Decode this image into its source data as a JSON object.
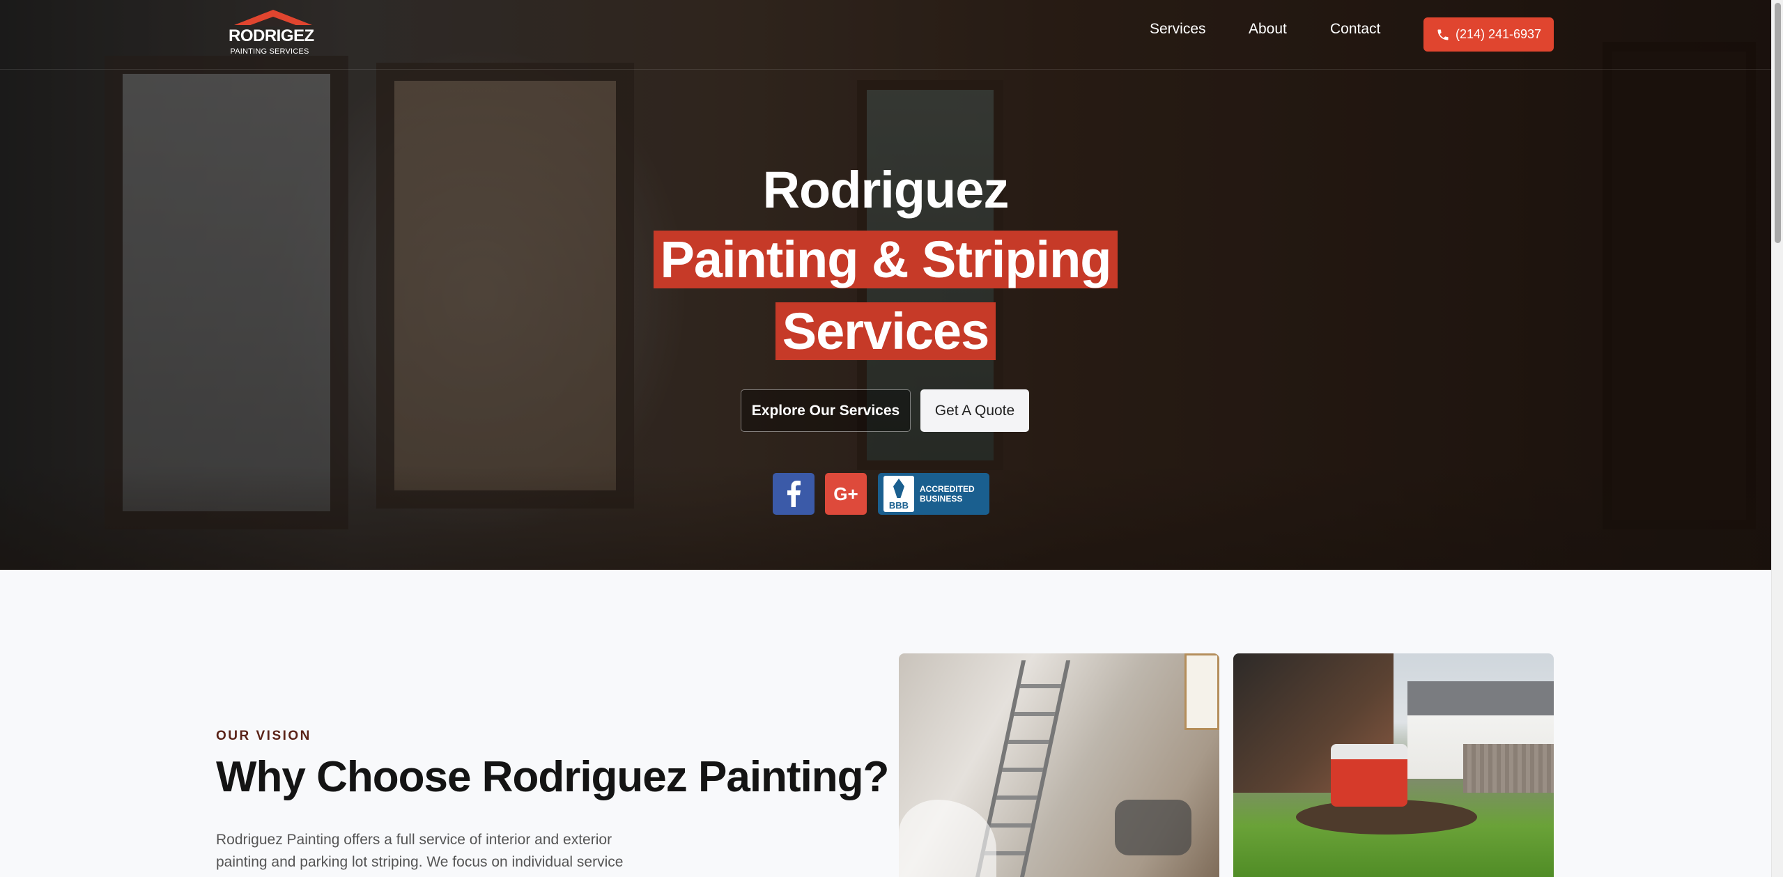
{
  "header": {
    "logo": {
      "line1": "RODRIGEZ",
      "line2": "PAINTING SERVICES"
    },
    "nav": [
      "Services",
      "About",
      "Contact"
    ],
    "phone": "(214) 241-6937",
    "phone_icon": "phone-icon"
  },
  "hero": {
    "title_line1": "Rodriguez",
    "title_line2": "Painting & Striping",
    "title_line3": "Services",
    "highlight_color": "#c63a28",
    "explore_button": "Explore Our Services",
    "quote_button": "Get A Quote",
    "social": {
      "facebook_icon": "facebook-icon",
      "google_plus_label": "G+",
      "bbb": {
        "seal": "BBB",
        "line1": "ACCREDITED",
        "line2": "BUSINESS"
      }
    }
  },
  "vision": {
    "eyebrow": "OUR VISION",
    "title": "Why Choose Rodriguez Painting?",
    "text": "Rodriguez Painting offers a full service of interior and exterior painting and parking lot striping. We focus on individual service"
  },
  "colors": {
    "accent": "#e0452f",
    "facebook": "#3b5aa8",
    "google_plus": "#de4a3b",
    "bbb": "#1a5f8f"
  }
}
